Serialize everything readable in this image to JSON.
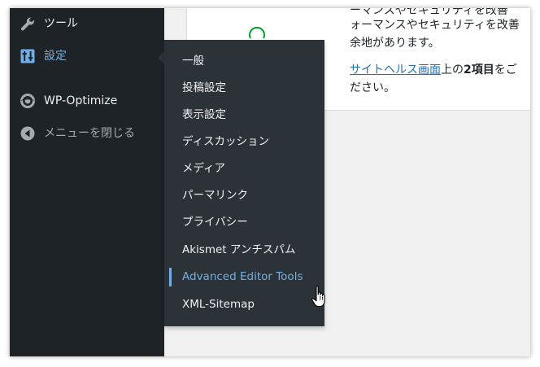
{
  "sidebar": {
    "items": [
      {
        "label": "ツール",
        "icon": "wrench-icon"
      },
      {
        "label": "設定",
        "icon": "settings-sliders-icon"
      },
      {
        "label": "WP-Optimize",
        "icon": "wp-optimize-icon"
      },
      {
        "label": "メニューを閉じる",
        "icon": "collapse-menu-icon"
      }
    ]
  },
  "submenu": {
    "items": [
      {
        "label": "一般"
      },
      {
        "label": "投稿設定"
      },
      {
        "label": "表示設定"
      },
      {
        "label": "ディスカッション"
      },
      {
        "label": "メディア"
      },
      {
        "label": "パーマリンク"
      },
      {
        "label": "プライバシー"
      },
      {
        "label": "Akismet アンチスパム"
      },
      {
        "label": "Advanced Editor Tools"
      },
      {
        "label": "XML-Sitemap"
      }
    ],
    "active_label": "Advanced Editor Tools"
  },
  "panel": {
    "line0": "ーマンスやセキュリティを改善",
    "line1": "ォーマンスやセキュリティを改善",
    "line2": "余地があります。",
    "link_text": "サイトヘルス画面",
    "line3_after": "上の",
    "line3_bold": "2項目",
    "line3_end": "をご",
    "line4": "ださい。"
  },
  "colors": {
    "sidebar_bg": "#1d2327",
    "submenu_bg": "#2c3338",
    "accent": "#72aee6",
    "link": "#2271b1",
    "text_light": "#f0f0f1"
  }
}
